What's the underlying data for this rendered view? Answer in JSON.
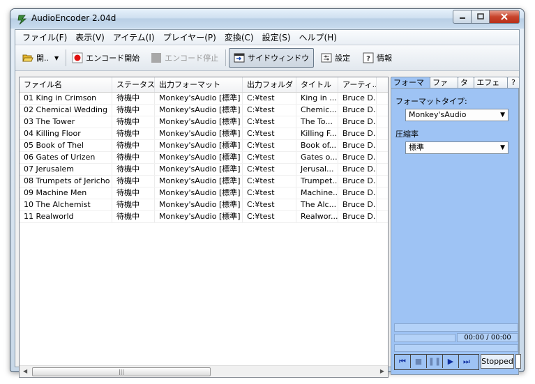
{
  "window": {
    "title": "AudioEncoder 2.04d"
  },
  "menu": [
    "ファイル(F)",
    "表示(V)",
    "アイテム(I)",
    "プレイヤー(P)",
    "変換(C)",
    "設定(S)",
    "ヘルプ(H)"
  ],
  "toolbar": {
    "open": "開..",
    "encode_start": "エンコード開始",
    "encode_stop": "エンコード停止",
    "side_window": "サイドウィンドウ",
    "settings": "設定",
    "info": "情報"
  },
  "list": {
    "columns": [
      "ファイル名",
      "ステータス",
      "出力フォーマット",
      "出力フォルダ",
      "タイトル",
      "アーティ..."
    ],
    "rows": [
      [
        "01 King in Crimson",
        "待機中",
        "Monkey'sAudio [標準]",
        "C:¥test",
        "King in ...",
        "Bruce D..."
      ],
      [
        "02 Chemical Wedding",
        "待機中",
        "Monkey'sAudio [標準]",
        "C:¥test",
        "Chemic...",
        "Bruce D..."
      ],
      [
        "03 The Tower",
        "待機中",
        "Monkey'sAudio [標準]",
        "C:¥test",
        "The To...",
        "Bruce D..."
      ],
      [
        "04 Killing Floor",
        "待機中",
        "Monkey'sAudio [標準]",
        "C:¥test",
        "Killing F...",
        "Bruce D..."
      ],
      [
        "05 Book of Thel",
        "待機中",
        "Monkey'sAudio [標準]",
        "C:¥test",
        "Book of...",
        "Bruce D..."
      ],
      [
        "06 Gates of Urizen",
        "待機中",
        "Monkey'sAudio [標準]",
        "C:¥test",
        "Gates o...",
        "Bruce D..."
      ],
      [
        "07 Jerusalem",
        "待機中",
        "Monkey'sAudio [標準]",
        "C:¥test",
        "Jerusal...",
        "Bruce D..."
      ],
      [
        "08 Trumpets of Jericho",
        "待機中",
        "Monkey'sAudio [標準]",
        "C:¥test",
        "Trumpet...",
        "Bruce D..."
      ],
      [
        "09 Machine Men",
        "待機中",
        "Monkey'sAudio [標準]",
        "C:¥test",
        "Machine...",
        "Bruce D..."
      ],
      [
        "10 The Alchemist",
        "待機中",
        "Monkey'sAudio [標準]",
        "C:¥test",
        "The Alc...",
        "Bruce D..."
      ],
      [
        "11 Realworld",
        "待機中",
        "Monkey'sAudio [標準]",
        "C:¥test",
        "Realwor...",
        "Bruce D..."
      ]
    ]
  },
  "side": {
    "tabs": [
      "フォーマット",
      "ファイル",
      "タグ",
      "エフェクト",
      "?"
    ],
    "format_type_label": "フォーマットタイプ:",
    "format_type_value": "Monkey'sAudio",
    "compression_label": "圧縮率",
    "compression_value": "標準",
    "time": "00:00 / 00:00",
    "status": "Stopped"
  }
}
